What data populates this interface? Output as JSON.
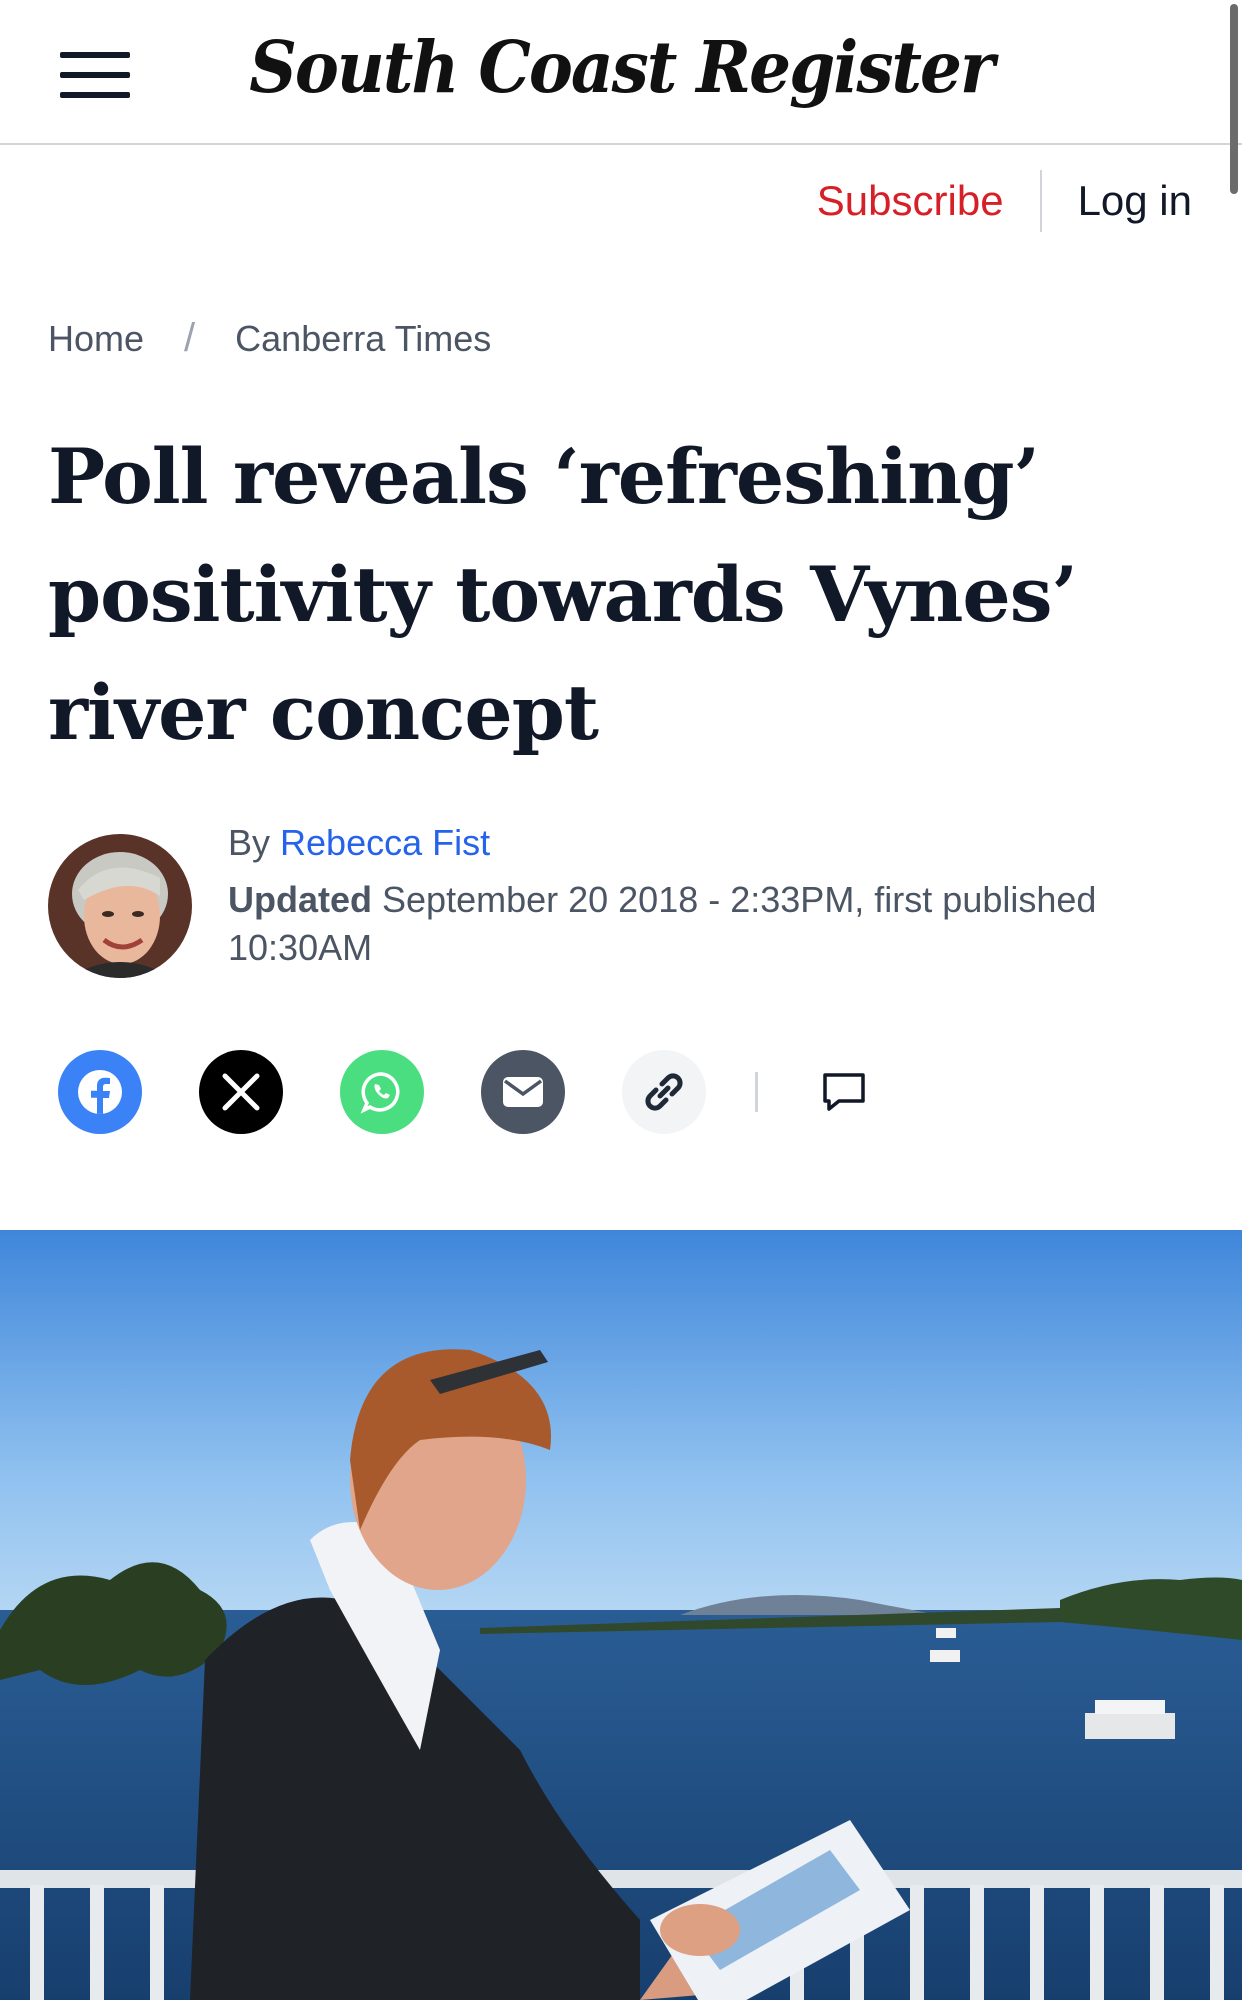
{
  "header": {
    "masthead": "South Coast Register",
    "menu_icon": "hamburger-menu-icon"
  },
  "account": {
    "subscribe_label": "Subscribe",
    "login_label": "Log in",
    "subscribe_color": "#d61f26"
  },
  "breadcrumb": {
    "items": [
      "Home",
      "Canberra Times"
    ],
    "separator": "/"
  },
  "article": {
    "headline_lines": [
      "Poll reveals ‘refreshing’",
      "positivity towards Vynes’",
      "river concept"
    ],
    "byline_prefix": "By",
    "author": "Rebecca Fist",
    "updated_label": "Updated",
    "updated_text": "September 20 2018 - 2:33PM, first published 10:30AM"
  },
  "share": {
    "buttons": [
      {
        "name": "facebook",
        "icon": "facebook-icon",
        "color": "#3b82f6"
      },
      {
        "name": "x",
        "icon": "x-icon",
        "color": "#000000"
      },
      {
        "name": "whatsapp",
        "icon": "whatsapp-icon",
        "color": "#4ade80"
      },
      {
        "name": "email",
        "icon": "envelope-icon",
        "color": "#4b5563"
      },
      {
        "name": "copy-link",
        "icon": "link-icon",
        "color": "#f3f4f6"
      }
    ],
    "comment_icon": "comment-icon"
  },
  "colors": {
    "link": "#2563eb",
    "text": "#111827",
    "muted": "#4b5563"
  }
}
